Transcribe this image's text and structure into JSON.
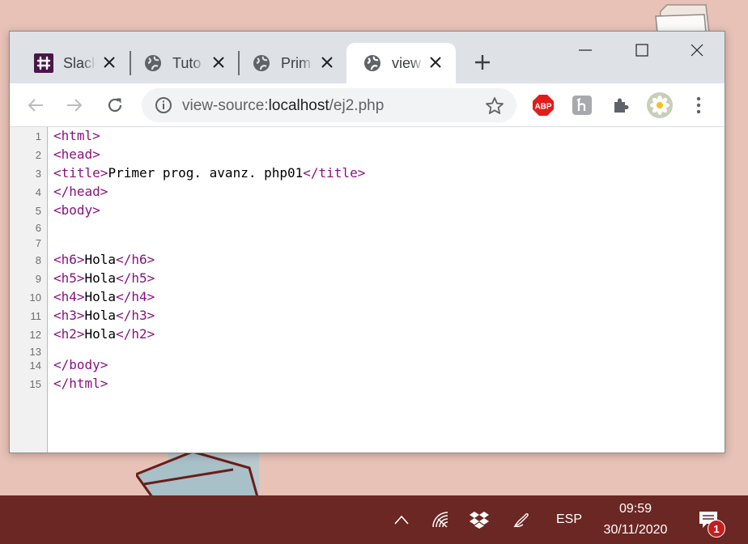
{
  "browser": {
    "tabs": [
      {
        "label": "Slack",
        "icon": "slack-icon",
        "active": false
      },
      {
        "label": "Tuto",
        "icon": "globe-icon",
        "active": false
      },
      {
        "label": "Prim",
        "icon": "globe-icon",
        "active": false
      },
      {
        "label": "view",
        "icon": "globe-icon",
        "active": true
      }
    ],
    "address": {
      "scheme": "view-source:",
      "host": "localhost",
      "path": "/ej2.php"
    },
    "extensions": {
      "abp": "ABP"
    }
  },
  "source": {
    "lines": [
      {
        "n": "1",
        "parts": [
          {
            "t": "tag",
            "v": "<html>"
          }
        ]
      },
      {
        "n": "2",
        "parts": [
          {
            "t": "tag",
            "v": "<head>"
          }
        ]
      },
      {
        "n": "3",
        "parts": [
          {
            "t": "tag",
            "v": "<title>"
          },
          {
            "t": "txt",
            "v": "Primer prog. avanz. php01"
          },
          {
            "t": "tag",
            "v": "</title>"
          }
        ]
      },
      {
        "n": "4",
        "parts": [
          {
            "t": "tag",
            "v": "</head>"
          }
        ]
      },
      {
        "n": "5",
        "parts": [
          {
            "t": "tag",
            "v": "<body>"
          }
        ]
      },
      {
        "n": "6",
        "parts": []
      },
      {
        "n": "7",
        "parts": []
      },
      {
        "n": "8",
        "parts": [
          {
            "t": "tag",
            "v": "<h6>"
          },
          {
            "t": "txt",
            "v": "Hola"
          },
          {
            "t": "tag",
            "v": "</h6>"
          }
        ]
      },
      {
        "n": "9",
        "parts": [
          {
            "t": "tag",
            "v": "<h5>"
          },
          {
            "t": "txt",
            "v": "Hola"
          },
          {
            "t": "tag",
            "v": "</h5>"
          }
        ]
      },
      {
        "n": "10",
        "parts": [
          {
            "t": "tag",
            "v": "<h4>"
          },
          {
            "t": "txt",
            "v": "Hola"
          },
          {
            "t": "tag",
            "v": "</h4>"
          }
        ]
      },
      {
        "n": "11",
        "parts": [
          {
            "t": "tag",
            "v": "<h3>"
          },
          {
            "t": "txt",
            "v": "Hola"
          },
          {
            "t": "tag",
            "v": "</h3>"
          }
        ]
      },
      {
        "n": "12",
        "parts": [
          {
            "t": "tag",
            "v": "<h2>"
          },
          {
            "t": "txt",
            "v": "Hola"
          },
          {
            "t": "tag",
            "v": "</h2>"
          }
        ]
      },
      {
        "n": "13",
        "parts": []
      },
      {
        "n": "14",
        "parts": [
          {
            "t": "tag",
            "v": "</body>"
          }
        ]
      },
      {
        "n": "15",
        "parts": [
          {
            "t": "tag",
            "v": "</html>"
          }
        ]
      }
    ]
  },
  "taskbar": {
    "language": "ESP",
    "time": "09:59",
    "date": "30/11/2020",
    "notification_count": "1"
  },
  "colors": {
    "tag": "#881280",
    "text": "#000000",
    "taskbar": "#6b2723"
  }
}
